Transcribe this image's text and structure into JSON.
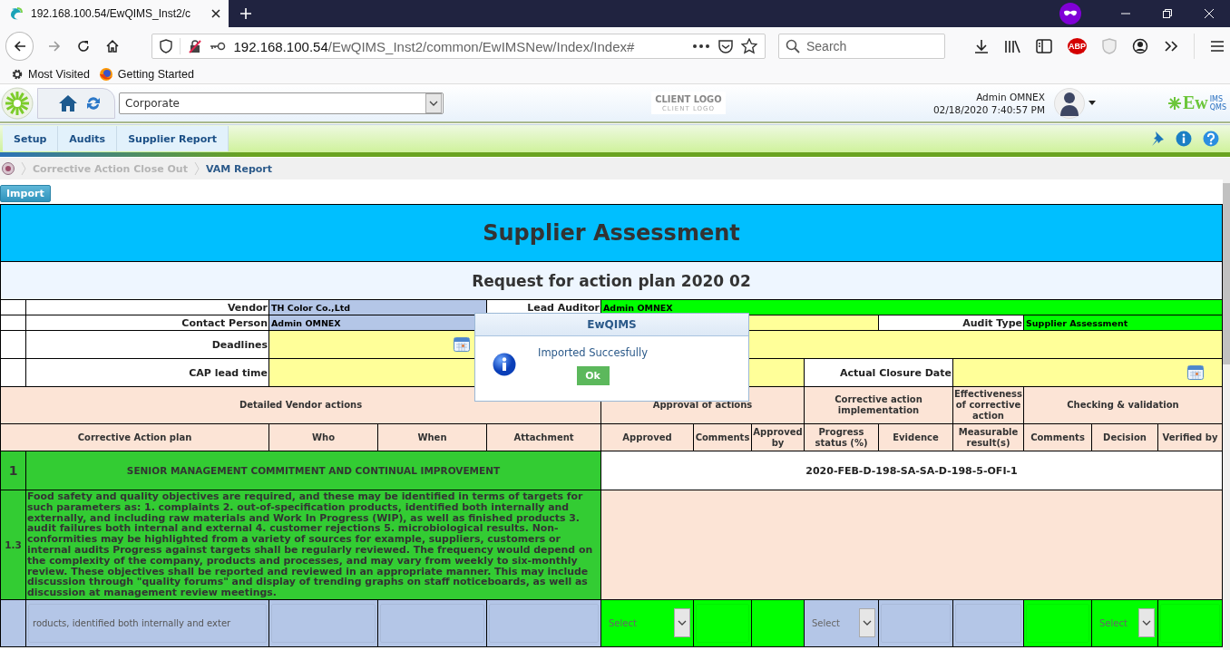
{
  "browser": {
    "tab_title": "192.168.100.54/EwQIMS_Inst2/c",
    "url_host": "192.168.100.54",
    "url_path": "/EwQIMS_Inst2/common/EwIMSNew/Index/Index#",
    "search_placeholder": "Search",
    "adblock_badge": "ABP",
    "bookmarks": [
      {
        "kind": "gear",
        "label": "Most Visited"
      },
      {
        "kind": "globe",
        "label": "Getting Started"
      }
    ]
  },
  "app_header": {
    "company_select": "Corporate",
    "client_logo": {
      "title": "CLIENT LOGO",
      "subtitle": "CLIENT LOGO"
    },
    "user_name": "Admin OMNEX",
    "datetime": "02/18/2020 7:40:57 PM",
    "brand": {
      "main": "Ew",
      "upper": "IMS",
      "lower": "QMS"
    }
  },
  "menu": [
    {
      "label": "Setup"
    },
    {
      "label": "Audits"
    },
    {
      "label": "Supplier Report"
    }
  ],
  "breadcrumb": [
    {
      "label": "Corrective Action Close Out",
      "current": false
    },
    {
      "label": "VAM Report",
      "current": true
    }
  ],
  "import_button": "Import",
  "form": {
    "title": "Supplier Assessment",
    "subtitle": "Request for action plan 2020 02",
    "info": [
      {
        "kind": "text",
        "label": "Vendor",
        "value": "TH Color Co.,Ltd"
      },
      {
        "kind": "text",
        "label": "Lead Auditor",
        "value": "Admin OMNEX"
      },
      {
        "kind": "text",
        "label": "Contact Person",
        "value": "Admin OMNEX"
      },
      {
        "kind": "text",
        "label": "Audit Type",
        "value": "Supplier Assessment"
      },
      {
        "kind": "date",
        "label": "Deadlines"
      },
      {
        "kind": "text",
        "label": "CAP lead time"
      },
      {
        "kind": "date",
        "label": "Actual Closure Date"
      }
    ],
    "column_groups": [
      "Detailed Vendor actions",
      "Approval of actions",
      "Corrective action implementation",
      "Effectiveness of corrective action",
      "Checking & validation"
    ],
    "columns": [
      "Corrective Action plan",
      "Who",
      "When",
      "Attachment",
      "Approved",
      "Comments",
      "Approved by",
      "Progress status (%)",
      "Evidence",
      "Measurable result(s)",
      "Comments",
      "Decision",
      "Verified by"
    ],
    "sections": [
      {
        "number": "1",
        "title": "SENIOR MANAGEMENT COMMITMENT AND CONTINUAL IMPROVEMENT",
        "code": "2020-FEB-D-198-SA-SA-D-198-5-OFI-1",
        "items": [
          {
            "number": "1.3",
            "text": "Food safety and quality objectives are required, and these may be identified in terms of targets for such parameters as: 1. complaints 2. out-of-specification products, identified both internally and externally, and including raw materials and Work In Progress (WIP), as well as finished products 3. audit failures both internal and external 4. customer rejections 5. microbiological results. Non-conformities may be highlighted from a variety of sources for example, suppliers, customers or internal audits Progress against targets shall be regularly reviewed. The frequency would depend on the complexity of the company, products and processes, and may vary from weekly to six-monthly review. These objectives shall be reported and reviewed in an appropriate manner. This may include discussion through \"quality forums\" and display of trending graphs on staff noticeboards, as well as discussion at management review meetings.",
            "entries": [
              {
                "kind": "blank"
              },
              {
                "kind": "text",
                "value": "roducts, identified both internally and exter"
              },
              {
                "kind": "text"
              },
              {
                "kind": "text"
              },
              {
                "kind": "text"
              },
              {
                "kind": "select",
                "value": "Select"
              },
              {
                "kind": "text"
              },
              {
                "kind": "blank"
              },
              {
                "kind": "select",
                "value": "Select"
              },
              {
                "kind": "text"
              },
              {
                "kind": "text"
              },
              {
                "kind": "text"
              },
              {
                "kind": "select",
                "value": "Select"
              },
              {
                "kind": "text"
              }
            ]
          }
        ]
      }
    ]
  },
  "dialog": {
    "title": "EwQIMS",
    "message": "Imported Succesfully",
    "button": "Ok"
  }
}
